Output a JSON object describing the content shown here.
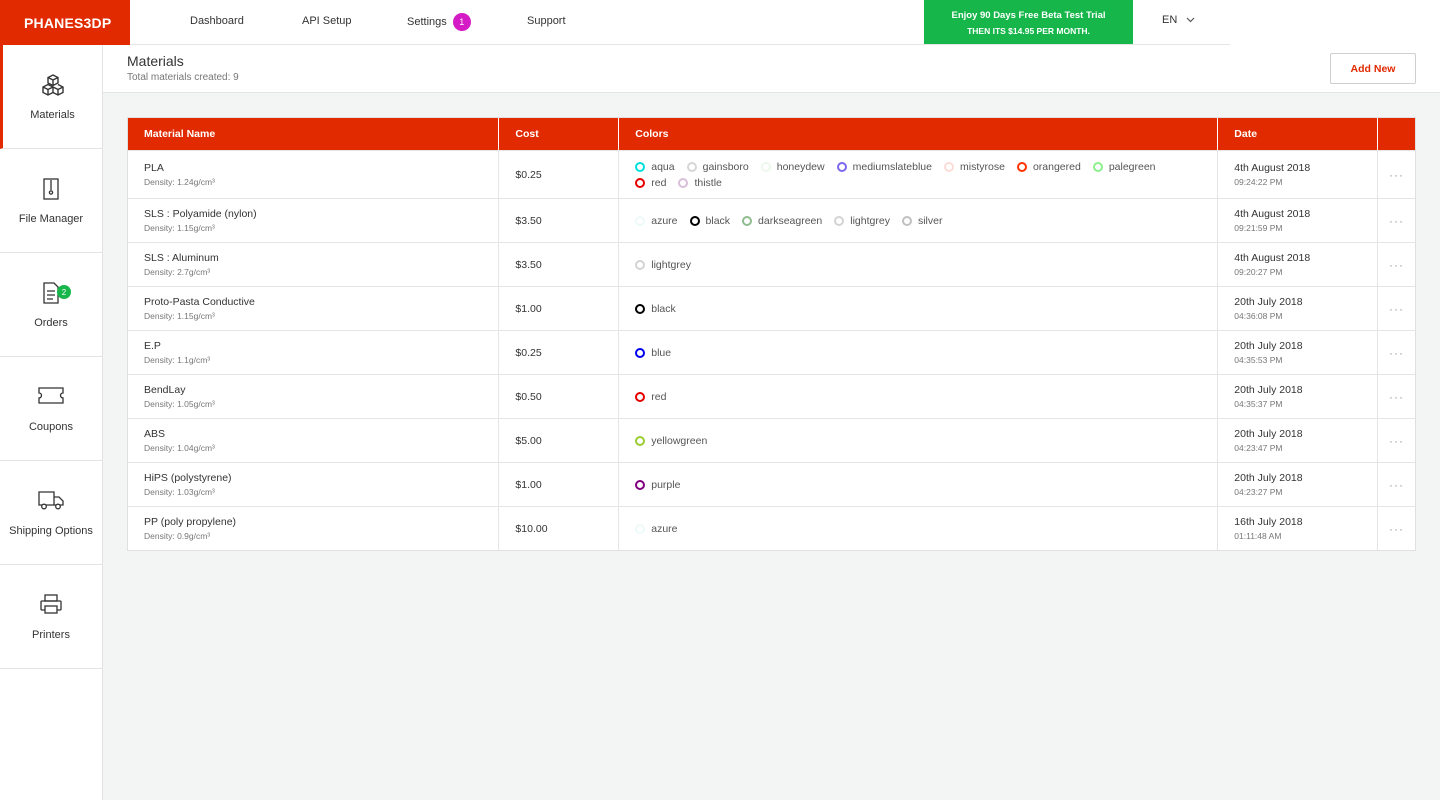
{
  "brand": "PHANES3DP",
  "nav": [
    {
      "label": "Dashboard"
    },
    {
      "label": "API Setup"
    },
    {
      "label": "Settings",
      "badge": "1"
    },
    {
      "label": "Support"
    }
  ],
  "promo": {
    "line1": "Enjoy 90 Days Free Beta Test Trial",
    "line2": "THEN ITS $14.95 PER MONTH."
  },
  "language": "EN",
  "sidebar": [
    {
      "label": "Materials",
      "icon": "cubes-icon",
      "active": true
    },
    {
      "label": "File Manager",
      "icon": "zip-file-icon"
    },
    {
      "label": "Orders",
      "icon": "document-icon",
      "badge": "2"
    },
    {
      "label": "Coupons",
      "icon": "ticket-icon"
    },
    {
      "label": "Shipping Options",
      "icon": "truck-icon"
    },
    {
      "label": "Printers",
      "icon": "printer-icon"
    }
  ],
  "header": {
    "title": "Materials",
    "subtitle": "Total materials created: 9",
    "add_label": "Add New"
  },
  "table": {
    "columns": [
      "Material Name",
      "Cost",
      "Colors",
      "Date",
      ""
    ],
    "more_label": "···",
    "rows": [
      {
        "name": "PLA",
        "density": "Density: 1.24g/cm³",
        "cost": "$0.25",
        "colors": [
          {
            "name": "aqua",
            "hex": "#00e0e0"
          },
          {
            "name": "gainsboro",
            "hex": "#d6d6d6"
          },
          {
            "name": "honeydew",
            "hex": "#ecf8ec"
          },
          {
            "name": "mediumslateblue",
            "hex": "#7b68ee"
          },
          {
            "name": "mistyrose",
            "hex": "#fbdcd8"
          },
          {
            "name": "orangered",
            "hex": "#ff3300"
          },
          {
            "name": "palegreen",
            "hex": "#8cf08c"
          },
          {
            "name": "red",
            "hex": "#e60000"
          },
          {
            "name": "thistle",
            "hex": "#d8bfd8"
          }
        ],
        "date": "4th August 2018",
        "time": "09:24:22 PM"
      },
      {
        "name": "SLS : Polyamide (nylon)",
        "density": "Density: 1.15g/cm³",
        "cost": "$3.50",
        "colors": [
          {
            "name": "azure",
            "hex": "#eef9f9"
          },
          {
            "name": "black",
            "hex": "#000000"
          },
          {
            "name": "darkseagreen",
            "hex": "#8fbc8f"
          },
          {
            "name": "lightgrey",
            "hex": "#d3d3d3"
          },
          {
            "name": "silver",
            "hex": "#c0c0c0"
          }
        ],
        "date": "4th August 2018",
        "time": "09:21:59 PM"
      },
      {
        "name": "SLS : Aluminum",
        "density": "Density: 2.7g/cm³",
        "cost": "$3.50",
        "colors": [
          {
            "name": "lightgrey",
            "hex": "#d3d3d3"
          }
        ],
        "date": "4th August 2018",
        "time": "09:20:27 PM"
      },
      {
        "name": "Proto-Pasta Conductive",
        "density": "Density: 1.15g/cm³",
        "cost": "$1.00",
        "colors": [
          {
            "name": "black",
            "hex": "#000000"
          }
        ],
        "date": "20th July 2018",
        "time": "04:36:08 PM"
      },
      {
        "name": "E.P",
        "density": "Density: 1.1g/cm³",
        "cost": "$0.25",
        "colors": [
          {
            "name": "blue",
            "hex": "#0000ee"
          }
        ],
        "date": "20th July 2018",
        "time": "04:35:53 PM"
      },
      {
        "name": "BendLay",
        "density": "Density: 1.05g/cm³",
        "cost": "$0.50",
        "colors": [
          {
            "name": "red",
            "hex": "#e60000"
          }
        ],
        "date": "20th July 2018",
        "time": "04:35:37 PM"
      },
      {
        "name": "ABS",
        "density": "Density: 1.04g/cm³",
        "cost": "$5.00",
        "colors": [
          {
            "name": "yellowgreen",
            "hex": "#9acd32"
          }
        ],
        "date": "20th July 2018",
        "time": "04:23:47 PM"
      },
      {
        "name": "HiPS (polystyrene)",
        "density": "Density: 1.03g/cm³",
        "cost": "$1.00",
        "colors": [
          {
            "name": "purple",
            "hex": "#800080"
          }
        ],
        "date": "20th July 2018",
        "time": "04:23:27 PM"
      },
      {
        "name": "PP (poly propylene)",
        "density": "Density: 0.9g/cm³",
        "cost": "$10.00",
        "colors": [
          {
            "name": "azure",
            "hex": "#eef9f9"
          }
        ],
        "date": "16th July 2018",
        "time": "01:11:48 AM"
      }
    ]
  },
  "theme": {
    "accent": "#e12a00",
    "promo": "#16b64a",
    "badge_settings": "#d51bc5",
    "badge_orders": "#16b64a"
  }
}
